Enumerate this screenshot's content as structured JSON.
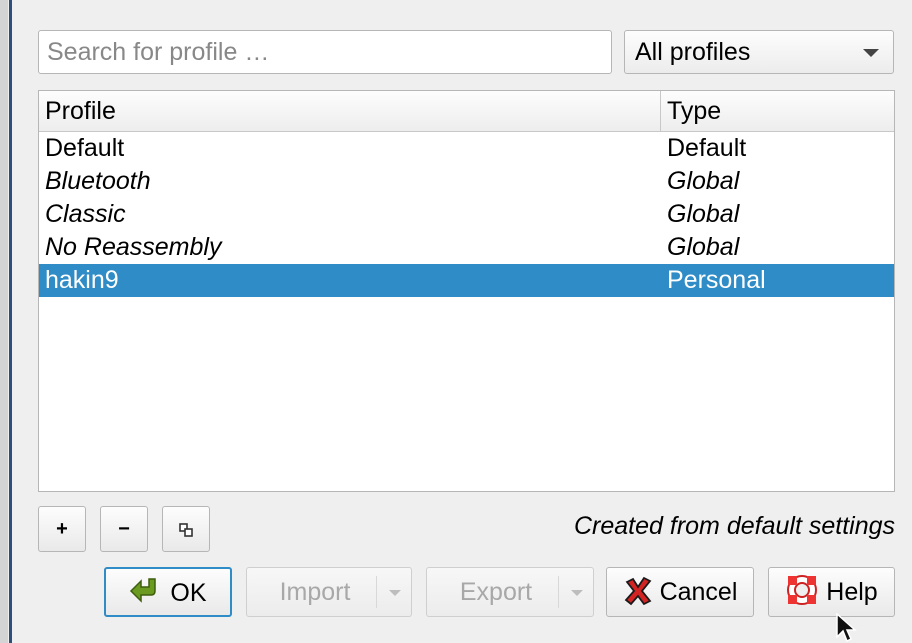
{
  "search": {
    "placeholder": "Search for profile …"
  },
  "filter": {
    "selected": "All profiles"
  },
  "table": {
    "columns": [
      "Profile",
      "Type"
    ],
    "rows": [
      {
        "profile": "Default",
        "type": "Default",
        "italic": false,
        "selected": false
      },
      {
        "profile": "Bluetooth",
        "type": "Global",
        "italic": true,
        "selected": false
      },
      {
        "profile": "Classic",
        "type": "Global",
        "italic": true,
        "selected": false
      },
      {
        "profile": "No Reassembly",
        "type": "Global",
        "italic": true,
        "selected": false
      },
      {
        "profile": "hakin9",
        "type": "Personal",
        "italic": false,
        "selected": true
      }
    ]
  },
  "toolbar": {
    "add_label": "+",
    "remove_label": "−",
    "copy_icon": "copy-icon",
    "status_note": "Created from default settings"
  },
  "buttons": {
    "ok": "OK",
    "import": "Import",
    "export": "Export",
    "cancel": "Cancel",
    "help": "Help"
  },
  "colors": {
    "selection": "#308cc6",
    "window_edge": "#2d4f79"
  }
}
